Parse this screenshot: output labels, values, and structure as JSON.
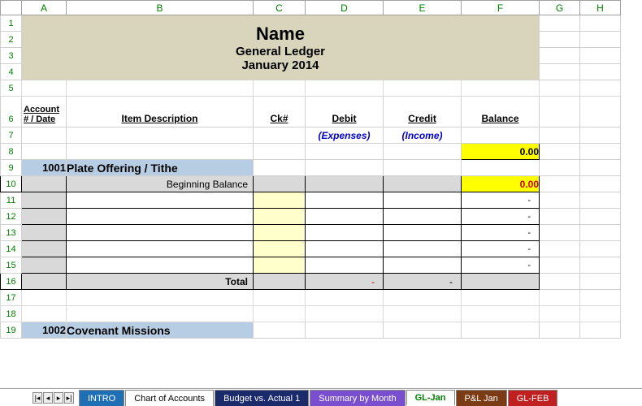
{
  "columns": [
    "A",
    "B",
    "C",
    "D",
    "E",
    "F",
    "G",
    "H"
  ],
  "rows": [
    1,
    2,
    3,
    4,
    5,
    6,
    7,
    8,
    9,
    10,
    11,
    12,
    13,
    14,
    15,
    16,
    17,
    18,
    19
  ],
  "title": {
    "name": "Name",
    "sub": "General Ledger",
    "month": "January 2014"
  },
  "headers": {
    "acct": "Account # / Date",
    "desc": "Item Description",
    "ck": "Ck#",
    "debit": "Debit",
    "credit": "Credit",
    "balance": "Balance",
    "debit_sub": "(Expenses)",
    "credit_sub": "(Income)"
  },
  "balance_top": "0.00",
  "accounts": [
    {
      "num": "1001",
      "name": "Plate Offering / Tithe",
      "begin_label": "Beginning Balance",
      "begin_val": "0.00",
      "entry_dash": "-",
      "total_label": "Total",
      "total_debit": "-",
      "total_credit": "-"
    },
    {
      "num": "1002",
      "name": "Covenant Missions"
    }
  ],
  "tabs": [
    {
      "label": "INTRO",
      "cls": "intro"
    },
    {
      "label": "Chart of Accounts",
      "cls": "coa"
    },
    {
      "label": "Budget vs. Actual 1",
      "cls": "budget"
    },
    {
      "label": "Summary by Month",
      "cls": "summary"
    },
    {
      "label": "GL-Jan",
      "cls": "gljan"
    },
    {
      "label": "P&L Jan",
      "cls": "pljan"
    },
    {
      "label": "GL-FEB",
      "cls": "glfeb"
    }
  ],
  "chart_data": {
    "type": "table",
    "title": "General Ledger — January 2014",
    "columns": [
      "Account # / Date",
      "Item Description",
      "Ck#",
      "Debit (Expenses)",
      "Credit (Income)",
      "Balance"
    ],
    "opening_balance": 0.0,
    "sections": [
      {
        "account": 1001,
        "name": "Plate Offering / Tithe",
        "beginning_balance": 0.0,
        "entries": [],
        "total_debit": 0,
        "total_credit": 0
      },
      {
        "account": 1002,
        "name": "Covenant Missions"
      }
    ]
  }
}
